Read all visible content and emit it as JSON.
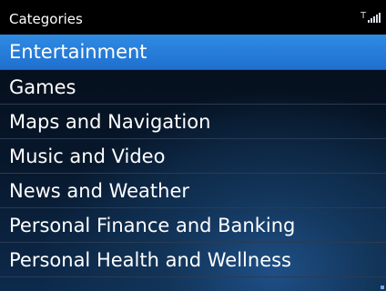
{
  "title_bar": {
    "title": "Categories",
    "signal_icon": "signal-strength-icon"
  },
  "colors": {
    "selected_bg": "#2a84de",
    "text": "#ffffff",
    "title_bg": "#000000"
  },
  "list": {
    "items": [
      {
        "label": "Entertainment",
        "selected": true
      },
      {
        "label": "Games",
        "selected": false
      },
      {
        "label": "Maps and Navigation",
        "selected": false
      },
      {
        "label": "Music and Video",
        "selected": false
      },
      {
        "label": "News and Weather",
        "selected": false
      },
      {
        "label": "Personal Finance and Banking",
        "selected": false
      },
      {
        "label": "Personal Health and Wellness",
        "selected": false
      }
    ]
  }
}
